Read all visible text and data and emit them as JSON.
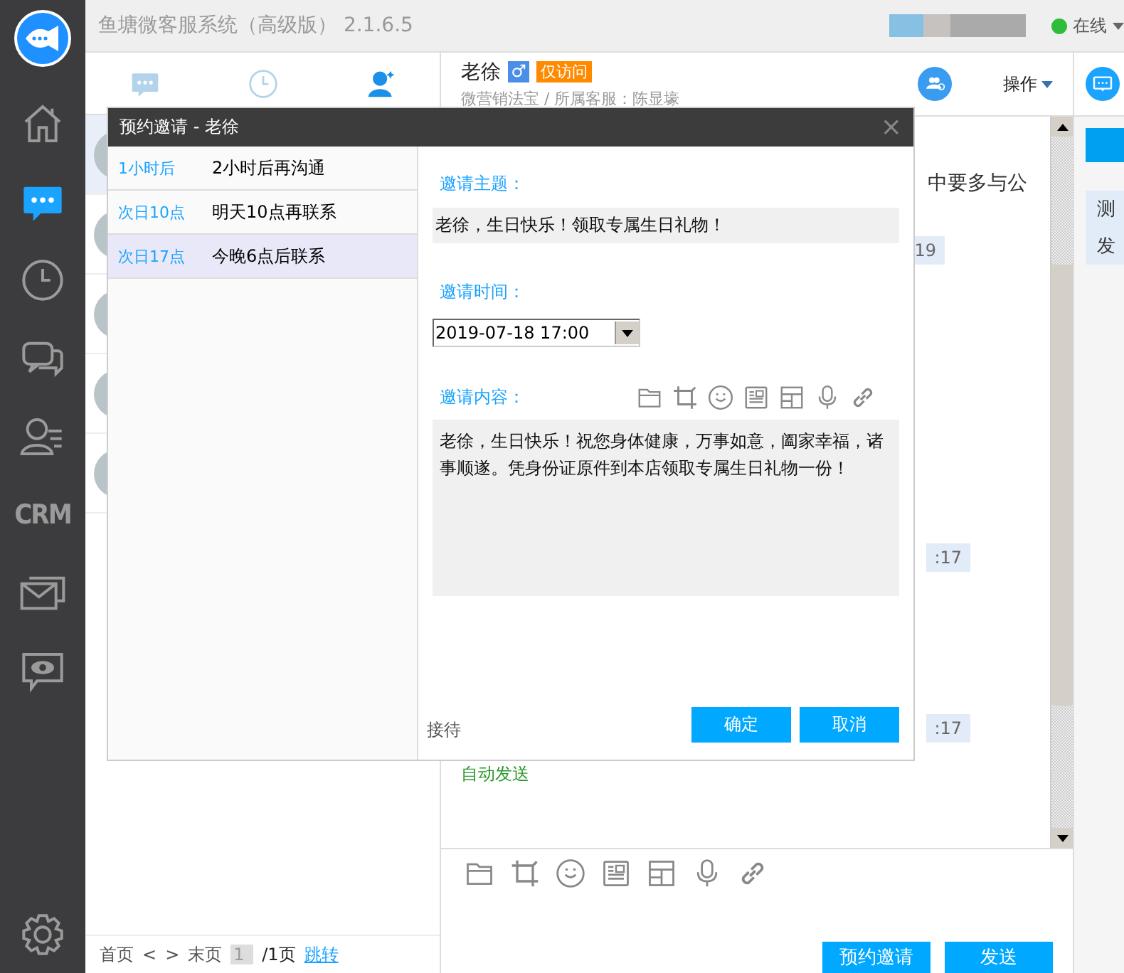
{
  "app": {
    "title": "鱼塘微客服系统（高级版） 2.1.6.5",
    "status": "在线",
    "online": true
  },
  "nav": {
    "items": [
      {
        "kind": "home",
        "selected": false
      },
      {
        "kind": "chat",
        "selected": true
      },
      {
        "kind": "history",
        "selected": false
      },
      {
        "kind": "messages",
        "selected": false
      },
      {
        "kind": "contacts",
        "selected": false
      },
      {
        "kind": "crm",
        "label": "CRM",
        "selected": false
      },
      {
        "kind": "mail",
        "selected": false
      },
      {
        "kind": "monitor",
        "selected": false
      }
    ]
  },
  "visitor_panel": {
    "tabs": [
      {
        "kind": "chat",
        "selected": false
      },
      {
        "kind": "history",
        "selected": false
      },
      {
        "kind": "contacts",
        "selected": true
      }
    ],
    "visitors": [
      {
        "selected": true
      },
      {
        "selected": false
      },
      {
        "selected": false
      },
      {
        "selected": false
      },
      {
        "selected": false
      }
    ],
    "pager": {
      "first": "首页",
      "prev": "<",
      "next": ">",
      "last": "末页",
      "page": "1",
      "total": "/1页",
      "jump": "跳转"
    }
  },
  "chat": {
    "name": "老徐",
    "gender": "♂",
    "badge": "仅访问",
    "subtitle": "微营销法宝 / 所属客服：陈显壕",
    "menu": "操作",
    "messages": [
      {
        "kind": "text",
        "text": "中要多与公"
      },
      {
        "kind": "time",
        "text": "19"
      },
      {
        "kind": "time",
        "text": ":17"
      },
      {
        "kind": "time",
        "text": ":17"
      },
      {
        "kind": "system",
        "text": "自动发送"
      }
    ],
    "buttons": [
      "预约邀请",
      "发送"
    ]
  },
  "side": {
    "items": [
      "测",
      "发"
    ]
  },
  "dialog": {
    "title": "预约邀请 - 老徐",
    "close": "×",
    "presets": [
      {
        "when": "1小时后",
        "text": "2小时后再沟通",
        "selected": false
      },
      {
        "when": "次日10点",
        "text": "明天10点再联系",
        "selected": false
      },
      {
        "when": "次日17点",
        "text": "今晚6点后联系",
        "selected": true
      }
    ],
    "subject_label": "邀请主题：",
    "subject": "老徐，生日快乐！领取专属生日礼物！",
    "time_label": "邀请时间：",
    "time": "2019-07-18 17:00",
    "content_label": "邀请内容：",
    "content": "老徐，生日快乐！祝您身体健康，万事如意，阖家幸福，诸事顺遂。凭身份证原件到本店领取专属生日礼物一份！",
    "footer": "接待",
    "buttons": [
      "确定",
      "取消"
    ]
  }
}
